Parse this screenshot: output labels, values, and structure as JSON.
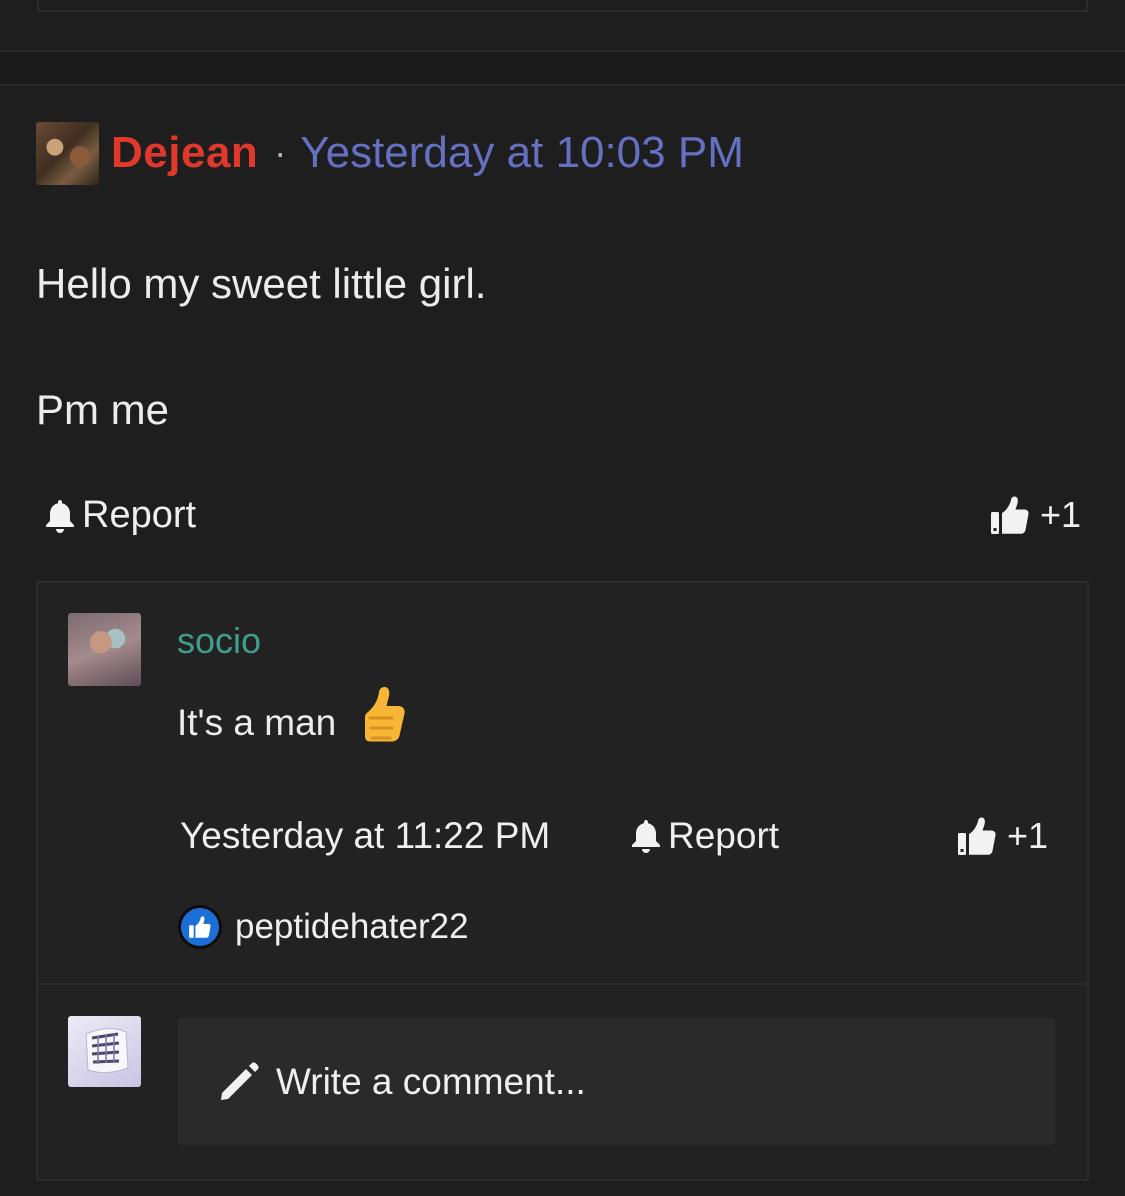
{
  "post": {
    "author": "Dejean",
    "separator": "·",
    "time": "Yesterday at 10:03 PM",
    "body": [
      "Hello my sweet little girl.",
      "Pm me"
    ],
    "report_label": "Report",
    "like_count": "+1"
  },
  "comment": {
    "author": "socio",
    "text": "It's a man",
    "emoji": "thumbs-up",
    "time": "Yesterday at 11:22 PM",
    "report_label": "Report",
    "like_count": "+1",
    "liked_by": "peptidehater22"
  },
  "composer": {
    "placeholder": "Write a comment..."
  },
  "colors": {
    "background": "#1e1e1f",
    "author_red": "#e0392b",
    "time_blue": "#6570c2",
    "commenter_teal": "#3f9e8b",
    "like_badge_blue": "#1c6fd6"
  }
}
